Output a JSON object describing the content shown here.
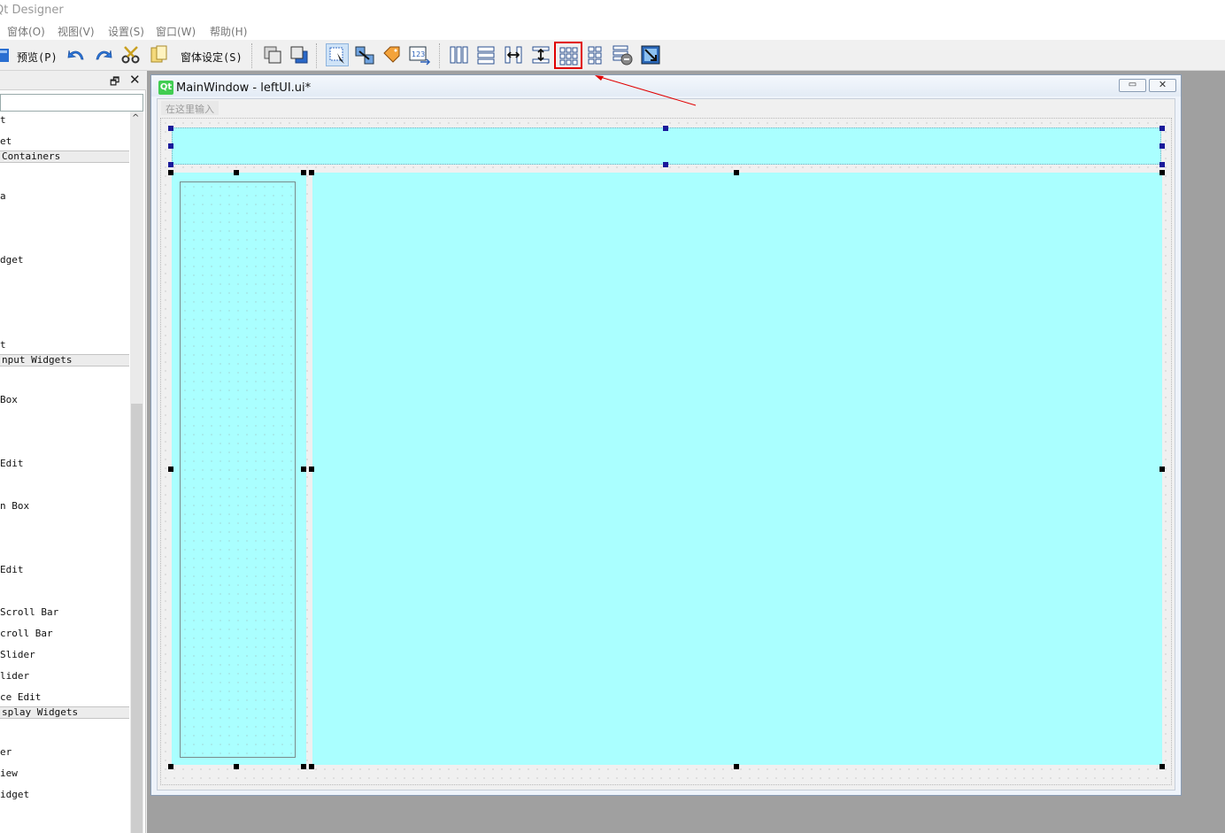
{
  "app": {
    "title": "Qt Designer"
  },
  "menubar": {
    "items": [
      "窗体(O)",
      "视图(V)",
      "设置(S)",
      "窗口(W)",
      "帮助(H)"
    ]
  },
  "toolbar": {
    "preview_label": "预览(P)",
    "form_settings_label": "窗体设定(S)",
    "buttons": [
      "open-icon",
      "undo-icon",
      "redo-icon",
      "cut-icon",
      "paste-icon",
      "bring-to-front-icon",
      "send-to-back-icon",
      "edit-widgets-icon",
      "edit-signals-slots-icon",
      "edit-buddies-icon",
      "edit-tab-order-icon",
      "layout-horizontal-icon",
      "layout-vertical-icon",
      "layout-horizontal-splitter-icon",
      "layout-vertical-splitter-icon",
      "layout-grid-icon",
      "layout-form-icon",
      "break-layout-icon",
      "adjust-size-icon"
    ],
    "highlighted_button": "layout-grid-icon"
  },
  "widget_box": {
    "float_glyph": "🗗",
    "close_glyph": "✕",
    "filter_value": "",
    "items": [
      {
        "kind": "item",
        "label": "t"
      },
      {
        "kind": "item",
        "label": "et"
      },
      {
        "kind": "category",
        "label": " Containers"
      },
      {
        "kind": "item",
        "label": "a"
      },
      {
        "kind": "item",
        "label": "dget"
      },
      {
        "kind": "item",
        "label": "t"
      },
      {
        "kind": "category",
        "label": "nput Widgets"
      },
      {
        "kind": "item",
        "label": " Box"
      },
      {
        "kind": "item",
        "label": " Edit"
      },
      {
        "kind": "item",
        "label": "n Box"
      },
      {
        "kind": "item",
        "label": "Edit"
      },
      {
        "kind": "item",
        "label": " Scroll Bar"
      },
      {
        "kind": "item",
        "label": "croll Bar"
      },
      {
        "kind": "item",
        "label": " Slider"
      },
      {
        "kind": "item",
        "label": "lider"
      },
      {
        "kind": "item",
        "label": "ce Edit"
      },
      {
        "kind": "category",
        "label": "splay Widgets"
      },
      {
        "kind": "item",
        "label": "er"
      },
      {
        "kind": "item",
        "label": "iew"
      },
      {
        "kind": "item",
        "label": "idget"
      }
    ]
  },
  "form_window": {
    "logo": "Qt",
    "title": "MainWindow - leftUI.ui*",
    "minimize_glyph": "▭",
    "close_glyph": "✕",
    "menubar_placeholder": "在这里输入"
  },
  "colors": {
    "panel_fill": "#aaffff",
    "annotation": "#e00000"
  }
}
